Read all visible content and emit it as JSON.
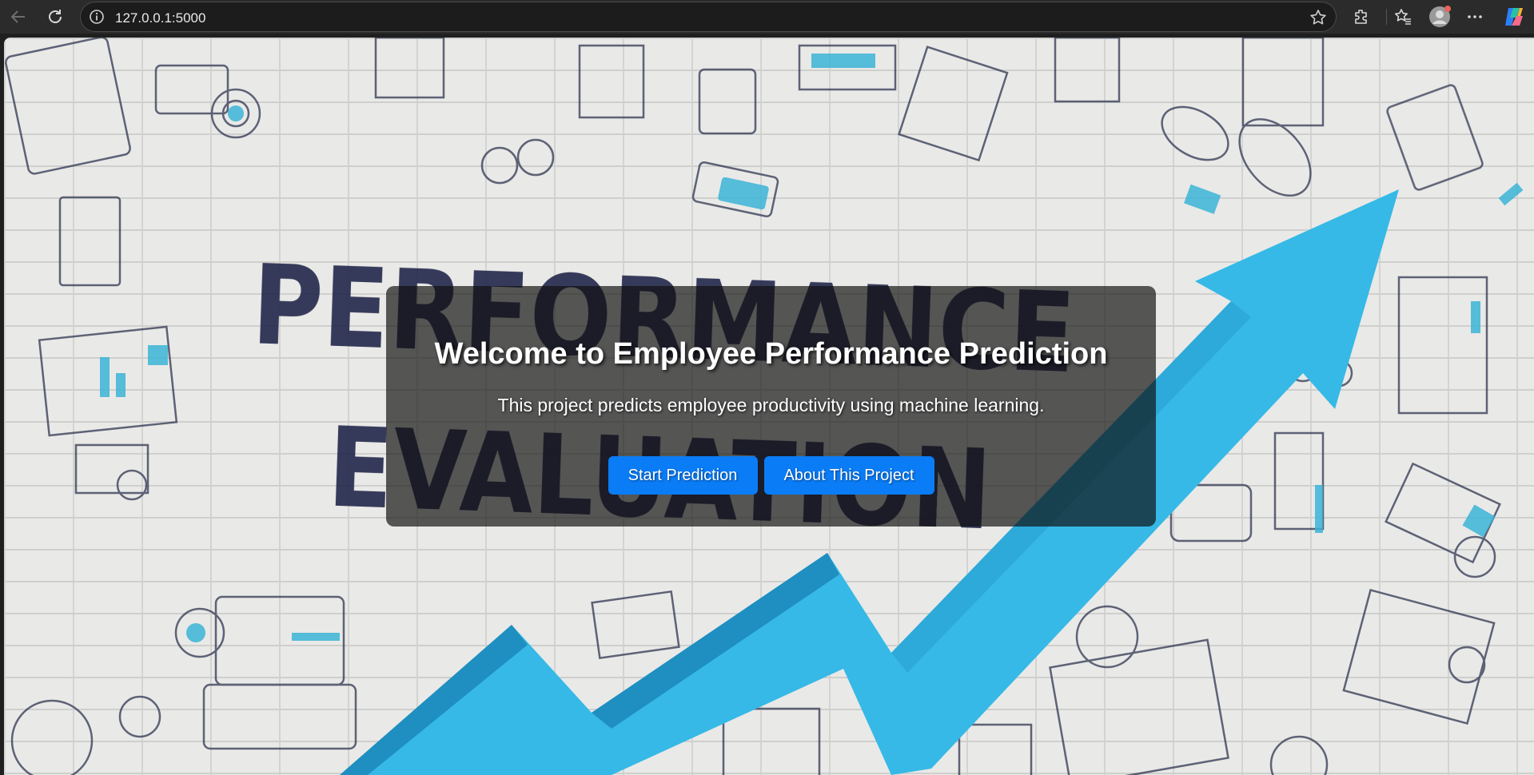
{
  "browser": {
    "url": "127.0.0.1:5000"
  },
  "hero": {
    "wall_text_line1": "PERFORMANCE",
    "wall_text_line2": "EVALUATION",
    "title": "Welcome to Employee Performance Prediction",
    "subtitle": "This project predicts employee productivity using machine learning.",
    "buttons": {
      "start": "Start Prediction",
      "about": "About This Project"
    }
  },
  "colors": {
    "button": "#0a7cf6",
    "arrow": "#35b9e6",
    "wall_text": "#22264a",
    "chrome": "#2b2b2b"
  }
}
